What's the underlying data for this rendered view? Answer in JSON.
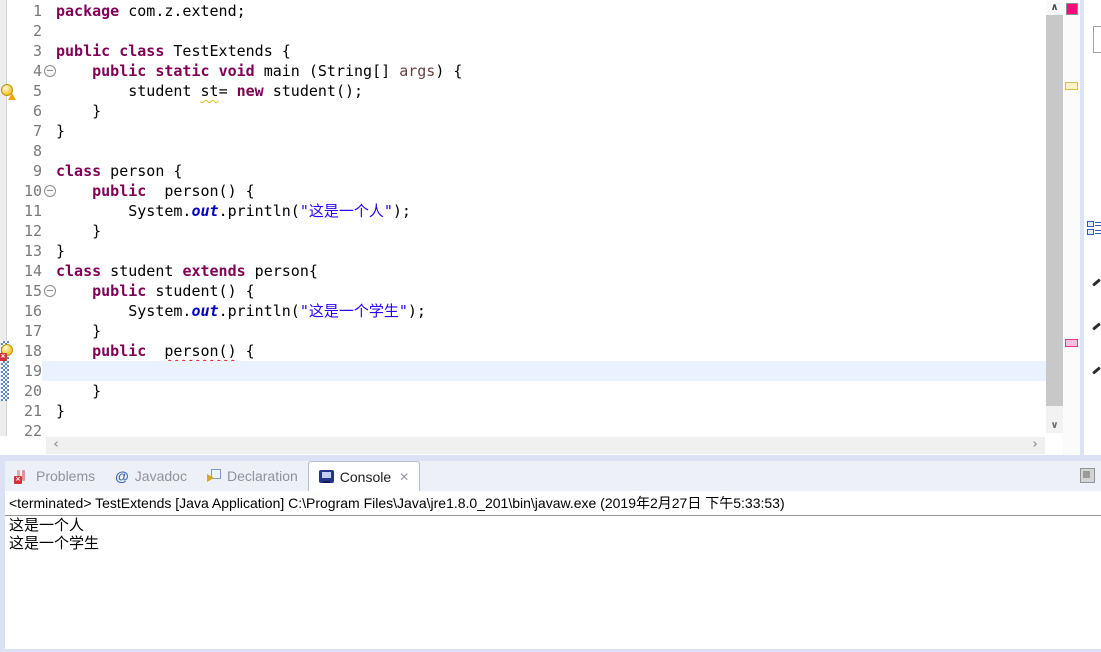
{
  "colors": {
    "kw": "#7f0055",
    "str": "#2a00ff",
    "fld": "#0000c0",
    "param": "#6a3e3e",
    "lineno": "#787878",
    "curline": "#e9f2fe",
    "warn": "#dcc520",
    "err": "#e01919",
    "hatch": "#5b87c5",
    "sash": "#dce2f4",
    "tabbar": "#eef0f8",
    "tabfg": "#8d929e",
    "tabborder": "#b8bfd2"
  },
  "glyphs": {
    "scroll_up": "∧",
    "scroll_down": "∨",
    "scroll_left": "‹",
    "scroll_right": "›",
    "close": "✕",
    "javadoc_at": "@"
  },
  "editor": {
    "language": "java",
    "lines": [
      {
        "no": "1",
        "tokens": [
          [
            "kw",
            "package"
          ],
          [
            "pl",
            " com.z.extend;"
          ]
        ]
      },
      {
        "no": "2",
        "tokens": []
      },
      {
        "no": "3",
        "tokens": [
          [
            "kw",
            "public"
          ],
          [
            "pl",
            " "
          ],
          [
            "kw",
            "class"
          ],
          [
            "pl",
            " TestExtends {"
          ]
        ]
      },
      {
        "no": "4",
        "fold": true,
        "tokens": [
          [
            "pl",
            "    "
          ],
          [
            "kw",
            "public"
          ],
          [
            "pl",
            " "
          ],
          [
            "kw",
            "static"
          ],
          [
            "pl",
            " "
          ],
          [
            "kw",
            "void"
          ],
          [
            "pl",
            " main (String[] "
          ],
          [
            "param",
            "args"
          ],
          [
            "pl",
            ") {"
          ]
        ]
      },
      {
        "no": "5",
        "warn": true,
        "tokens": [
          [
            "pl",
            "        student "
          ],
          [
            "wul",
            "st"
          ],
          [
            "pl",
            "= "
          ],
          [
            "kw",
            "new"
          ],
          [
            "pl",
            " student();"
          ]
        ]
      },
      {
        "no": "6",
        "tokens": [
          [
            "pl",
            "    }"
          ]
        ]
      },
      {
        "no": "7",
        "tokens": [
          [
            "pl",
            "}"
          ]
        ]
      },
      {
        "no": "8",
        "tokens": []
      },
      {
        "no": "9",
        "tokens": [
          [
            "kw",
            "class"
          ],
          [
            "pl",
            " person {"
          ]
        ]
      },
      {
        "no": "10",
        "fold": true,
        "tokens": [
          [
            "pl",
            "    "
          ],
          [
            "kw",
            "public"
          ],
          [
            "pl",
            "  person() {"
          ]
        ]
      },
      {
        "no": "11",
        "tokens": [
          [
            "pl",
            "        System."
          ],
          [
            "fld",
            "out"
          ],
          [
            "pl",
            ".println("
          ],
          [
            "str",
            "\"这是一个人\""
          ],
          [
            "pl",
            ");"
          ]
        ]
      },
      {
        "no": "12",
        "tokens": [
          [
            "pl",
            "    }"
          ]
        ]
      },
      {
        "no": "13",
        "tokens": [
          [
            "pl",
            "}"
          ]
        ]
      },
      {
        "no": "14",
        "tokens": [
          [
            "kw",
            "class"
          ],
          [
            "pl",
            " student "
          ],
          [
            "kw",
            "extends"
          ],
          [
            "pl",
            " person{"
          ]
        ]
      },
      {
        "no": "15",
        "fold": true,
        "tokens": [
          [
            "pl",
            "    "
          ],
          [
            "kw",
            "public"
          ],
          [
            "pl",
            " student() {"
          ]
        ]
      },
      {
        "no": "16",
        "tokens": [
          [
            "pl",
            "        System."
          ],
          [
            "fld",
            "out"
          ],
          [
            "pl",
            ".println("
          ],
          [
            "str",
            "\"这是一个学生\""
          ],
          [
            "pl",
            ");"
          ]
        ]
      },
      {
        "no": "17",
        "tokens": [
          [
            "pl",
            "    }"
          ]
        ]
      },
      {
        "no": "18",
        "error": true,
        "hatch": true,
        "tokens": [
          [
            "pl",
            "    "
          ],
          [
            "kw",
            "public"
          ],
          [
            "pl",
            "  "
          ],
          [
            "eul",
            "person()"
          ],
          [
            "pl",
            " {"
          ]
        ]
      },
      {
        "no": "19",
        "hatch": true,
        "current": true,
        "tokens": []
      },
      {
        "no": "20",
        "hatch": true,
        "tokens": [
          [
            "pl",
            "    }"
          ]
        ]
      },
      {
        "no": "21",
        "tokens": [
          [
            "pl",
            "}"
          ]
        ]
      },
      {
        "no": "22",
        "tokens": []
      }
    ]
  },
  "console": {
    "tabs": [
      {
        "label": "Problems",
        "active": false
      },
      {
        "label": "Javadoc",
        "active": false
      },
      {
        "label": "Declaration",
        "active": false
      },
      {
        "label": "Console",
        "active": true
      }
    ],
    "status": "<terminated> TestExtends [Java Application] C:\\Program Files\\Java\\jre1.8.0_201\\bin\\javaw.exe (2019年2月27日 下午5:33:53)",
    "output": [
      "这是一个人",
      "这是一个学生"
    ]
  }
}
